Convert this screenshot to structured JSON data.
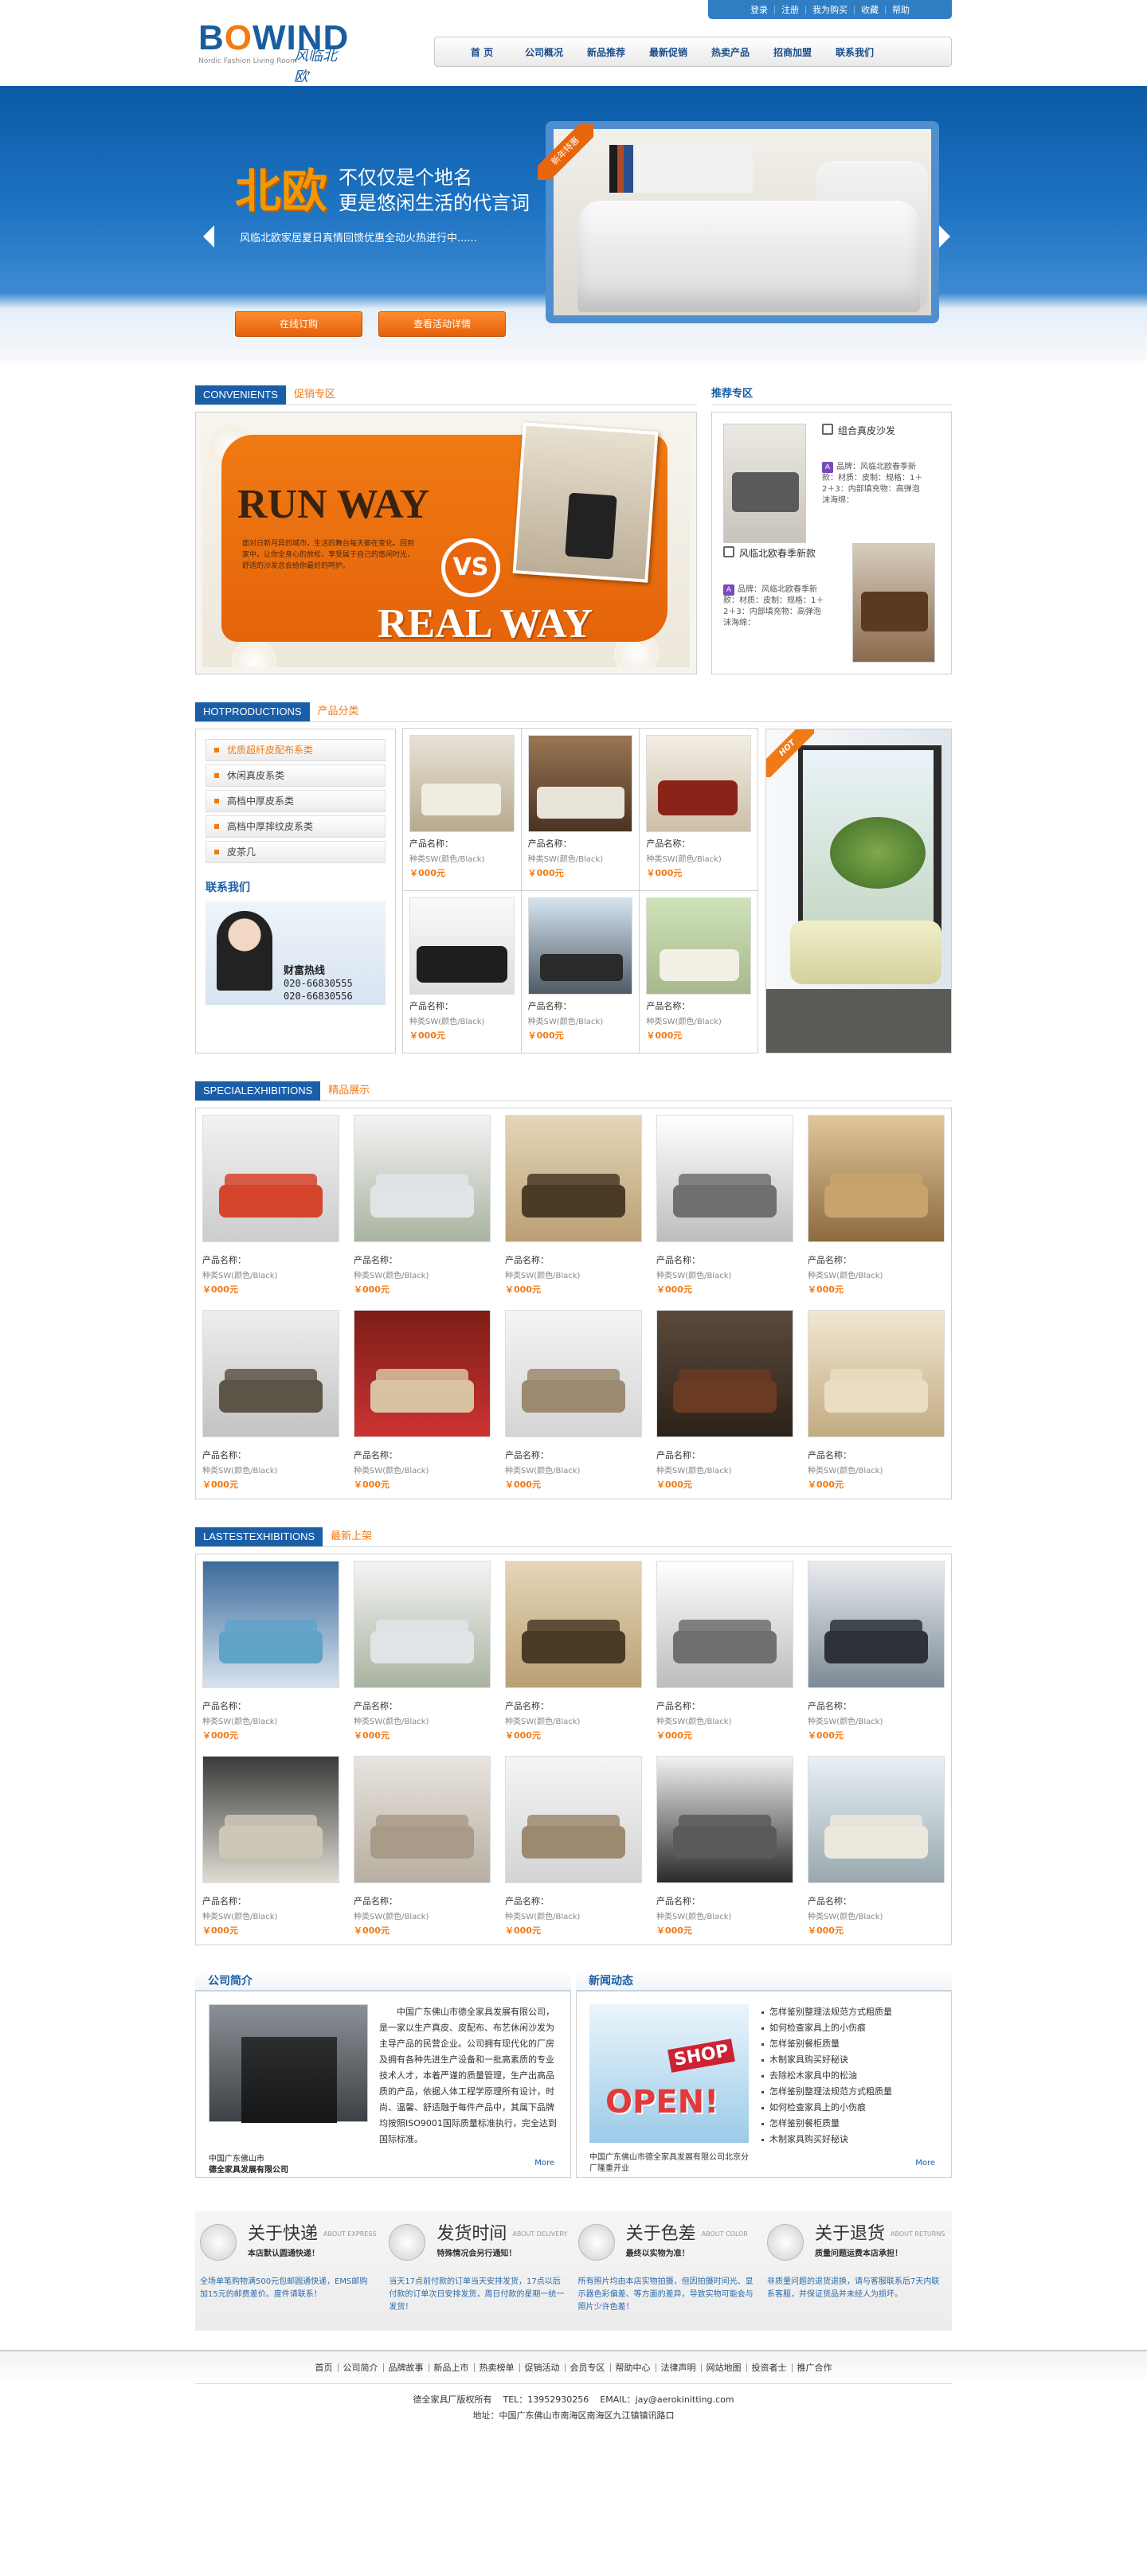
{
  "header": {
    "logo_text_pre": "B",
    "logo_text_o": "O",
    "logo_text_post": "WIND",
    "logo_sub": "Nordic Fashion Living Room",
    "logo_script": "风临北欧",
    "top_links": [
      "登录",
      "注册",
      "我为购买",
      "收藏",
      "帮助"
    ],
    "nav": [
      "首 页",
      "公司概况",
      "新品推荐",
      "最新促销",
      "热卖产品",
      "招商加盟",
      "联系我们"
    ]
  },
  "banner": {
    "big": "北欧",
    "line1": "不仅仅是个地名",
    "line2": "更是悠闲生活的代言词",
    "sub": "风临北欧家居夏日真情回馈优惠全动火热进行中......",
    "btn1": "在线订购",
    "btn2": "查看活动详情",
    "ribbon": "新年特惠"
  },
  "promo": {
    "en": "CONVENIENTS",
    "cn": "促销专区",
    "title1": "RUN WAY",
    "vs": "VS",
    "title2": "REAL WAY",
    "text": "面对日新月异的城市，生活的舞台每天都在变化。回到家中，让你全身心的放松，享受属于自己的悠闲时光，舒适的沙发总会给你最好的呵护。"
  },
  "recommend": {
    "title": "推荐专区",
    "items": [
      {
        "title": "组合真皮沙发",
        "desc1": "品牌：风临北欧春季新款：",
        "desc2": "材质：皮制：规格：1＋2＋3：内部填充物：高弹泡沫海绵："
      },
      {
        "title": "风临北欧春季新款",
        "desc1": "品牌：风临北欧春季新款：",
        "desc2": "材质：皮制：规格：1＋2＋3：内部填充物：高弹泡沫海绵："
      }
    ]
  },
  "hot": {
    "en": "HOTPRODUCTIONS",
    "cn": "产品分类",
    "categories": [
      "优质超纤皮配布系类",
      "休闲真皮系类",
      "高档中厚皮系类",
      "高档中厚摔纹皮系类",
      "皮茶几"
    ],
    "contact_title": "联系我们",
    "hotline_label": "财富热线",
    "phone1": "020-66830555",
    "phone2": "020-66830556",
    "tag": "HOT",
    "products": [
      {
        "name": "产品名称：",
        "spec": "种类SW(颜色/Black)",
        "price": "￥000元"
      },
      {
        "name": "产品名称：",
        "spec": "种类SW(颜色/Black)",
        "price": "￥000元"
      },
      {
        "name": "产品名称：",
        "spec": "种类SW(颜色/Black)",
        "price": "￥000元"
      },
      {
        "name": "产品名称：",
        "spec": "种类SW(颜色/Black)",
        "price": "￥000元"
      },
      {
        "name": "产品名称：",
        "spec": "种类SW(颜色/Black)",
        "price": "￥000元"
      },
      {
        "name": "产品名称：",
        "spec": "种类SW(颜色/Black)",
        "price": "￥000元"
      }
    ]
  },
  "special": {
    "en": "SPECIALEXHIBITIONS",
    "cn": "精品展示",
    "items": [
      {
        "name": "产品名称：",
        "spec": "种类SW(颜色/Black)",
        "price": "￥000元"
      },
      {
        "name": "产品名称：",
        "spec": "种类SW(颜色/Black)",
        "price": "￥000元"
      },
      {
        "name": "产品名称：",
        "spec": "种类SW(颜色/Black)",
        "price": "￥000元"
      },
      {
        "name": "产品名称：",
        "spec": "种类SW(颜色/Black)",
        "price": "￥000元"
      },
      {
        "name": "产品名称：",
        "spec": "种类SW(颜色/Black)",
        "price": "￥000元"
      },
      {
        "name": "产品名称：",
        "spec": "种类SW(颜色/Black)",
        "price": "￥000元"
      },
      {
        "name": "产品名称：",
        "spec": "种类SW(颜色/Black)",
        "price": "￥000元"
      },
      {
        "name": "产品名称：",
        "spec": "种类SW(颜色/Black)",
        "price": "￥000元"
      },
      {
        "name": "产品名称：",
        "spec": "种类SW(颜色/Black)",
        "price": "￥000元"
      },
      {
        "name": "产品名称：",
        "spec": "种类SW(颜色/Black)",
        "price": "￥000元"
      }
    ]
  },
  "latest": {
    "en": "LASTESTEXHIBITIONS",
    "cn": "最新上架",
    "items": [
      {
        "name": "产品名称：",
        "spec": "种类SW(颜色/Black)",
        "price": "￥000元"
      },
      {
        "name": "产品名称：",
        "spec": "种类SW(颜色/Black)",
        "price": "￥000元"
      },
      {
        "name": "产品名称：",
        "spec": "种类SW(颜色/Black)",
        "price": "￥000元"
      },
      {
        "name": "产品名称：",
        "spec": "种类SW(颜色/Black)",
        "price": "￥000元"
      },
      {
        "name": "产品名称：",
        "spec": "种类SW(颜色/Black)",
        "price": "￥000元"
      },
      {
        "name": "产品名称：",
        "spec": "种类SW(颜色/Black)",
        "price": "￥000元"
      },
      {
        "name": "产品名称：",
        "spec": "种类SW(颜色/Black)",
        "price": "￥000元"
      },
      {
        "name": "产品名称：",
        "spec": "种类SW(颜色/Black)",
        "price": "￥000元"
      },
      {
        "name": "产品名称：",
        "spec": "种类SW(颜色/Black)",
        "price": "￥000元"
      },
      {
        "name": "产品名称：",
        "spec": "种类SW(颜色/Black)",
        "price": "￥000元"
      }
    ]
  },
  "about": {
    "title": "公司简介",
    "text": "中国广东佛山市德全家具发展有限公司，是一家以生产真皮、皮配布、布艺休闲沙发为主导产品的民营企业。公司拥有现代化的厂房及拥有各种先进生产设备和一批高素质的专业技术人才，本着严谨的质量管理，生产出高品质的产品，依据人体工程学原理所有设计，时尚、温馨、舒适融于每件产品中，其属下品牌均按照ISO9001国际质量标准执行，完全达到国际标准。",
    "caption1": "中国广东佛山市",
    "caption2": "德全家具发展有限公司",
    "more": "More"
  },
  "news": {
    "title": "新闻动态",
    "img_shop": "SHOP",
    "img_open": "OPEN!",
    "caption": "中国广东佛山市德全家具发展有限公司北京分厂隆重开业",
    "items": [
      "怎样鉴别整理法规范方式粗质量",
      "如何检查家具上的小伤痕",
      "怎样鉴别餐柜质量",
      "木制家具购买好秘诀",
      "去除松木家具中的松油",
      "怎样鉴别整理法规范方式粗质量",
      "如何检查家具上的小伤痕",
      "怎样鉴别餐柜质量",
      "木制家具购买好秘诀"
    ],
    "more": "More"
  },
  "services": [
    {
      "title": "关于快递",
      "en": "ABOUT EXPRESS",
      "sub": "本店默认圆通快递！",
      "desc": "全场单笔购物满500元包邮圆通快递，EMS邮购加15元的邮费差价。度件请联系！"
    },
    {
      "title": "发货时间",
      "en": "ABOUT DELIVERY",
      "sub": "特殊情况会另行通知！",
      "desc": "当天17点前付款的订单当天安排发货，17点以后付款的订单次日安排发货，周日付款的星期一统一发货！"
    },
    {
      "title": "关于色差",
      "en": "ABOUT COLOR",
      "sub": "最终以实物为准！",
      "desc": "所有照片均由本店实物拍摄，但因拍摄时间光、显示器色彩偏差、等方面的差异，导致实物可能会与照片少许色差！"
    },
    {
      "title": "关于退货",
      "en": "ABOUT RETURNS",
      "sub": "质量问题运费本店承担！",
      "desc": "非质量问题的退货退换，请与客服联系后7天内联系客服，并保证货品并未经人为损坏。"
    }
  ],
  "footer": {
    "nav": [
      "首页",
      "公司简介",
      "品牌故事",
      "新品上市",
      "热卖榜单",
      "促销活动",
      "会员专区",
      "帮助中心",
      "法律声明",
      "网站地图",
      "投资者士",
      "推广合作"
    ],
    "company": "德全家具厂版权所有",
    "tel": "TEL：13952930256",
    "email": "EMAIL：jay@aerokinitting.com",
    "address": "地址：中国广东佛山市南海区南海区九江镇镇讯路口"
  }
}
